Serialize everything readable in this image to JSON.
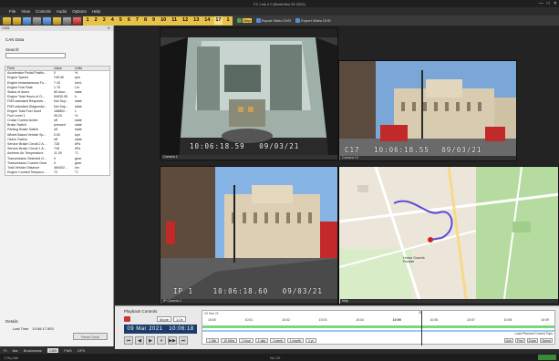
{
  "window": {
    "title": "FC Link 2.0 (Build Mar 25 2022)",
    "controls": [
      "—",
      "□",
      "✕"
    ]
  },
  "menu": [
    "File",
    "View",
    "Controls",
    "Audio",
    "Options",
    "Help"
  ],
  "toolbar": {
    "camera_numbers": [
      "1",
      "2",
      "3",
      "4",
      "5",
      "6",
      "7",
      "8",
      "9",
      "10",
      "11",
      "12",
      "13",
      "14",
      "17",
      "1"
    ],
    "map_label": "Map",
    "export_video_label": "Export Video DVD",
    "export_file_label": "Export Video DVD"
  },
  "left_panel": {
    "header_left": "CAN",
    "header_right": "✕",
    "title": "CAN Data",
    "search_label": "Search:",
    "search_value": "",
    "columns": [
      "Field",
      "Value",
      "Units"
    ],
    "rows": [
      [
        "Accelerator Pedal Positio...",
        "0",
        "%"
      ],
      [
        "Engine Speed",
        "749.50",
        "rpm"
      ],
      [
        "Engine Instantaneous Fu...",
        "7.30",
        "km/L"
      ],
      [
        "Engine Fuel Rate",
        "1.75",
        "L/h"
      ],
      [
        "Status of doors",
        "All door...",
        "state"
      ],
      [
        "Engine Total Hours of O...",
        "54630.95",
        "h"
      ],
      [
        "FMS-standard Requests...",
        "Not Sup...",
        "state"
      ],
      [
        "FMS-standard Diagnostic...",
        "Not Sup...",
        "state"
      ],
      [
        "Engine Total Fuel Used",
        "168802...",
        "L"
      ],
      [
        "Fuel Level 1",
        "95.20",
        "%"
      ],
      [
        "Cruise Control Active",
        "off",
        "state"
      ],
      [
        "Brake Switch",
        "pressed",
        "state"
      ],
      [
        "Parking Brake Switch",
        "off",
        "state"
      ],
      [
        "Wheel-Based Vehicle Sp...",
        "0.00",
        "kph"
      ],
      [
        "Clutch Switch",
        "off",
        "state"
      ],
      [
        "Service Brake Circuit 2 A...",
        "728",
        "kPa"
      ],
      [
        "Service Brake Circuit 1 A...",
        "728",
        "kPa"
      ],
      [
        "Ambient Air Temperature",
        "11.09",
        "°C"
      ],
      [
        "Transmission Selected G...",
        "0",
        "gear"
      ],
      [
        "Transmission Current Gear",
        "0",
        "gear"
      ],
      [
        "Total Vehicle Distance",
        "469402...",
        "km"
      ],
      [
        "Engine Coolant Tempera...",
        "72",
        "°C"
      ]
    ],
    "details_label": "Details",
    "last_time_label": "Last Time",
    "last_time_value": "10:06:17.593",
    "reset_label": "Reset Data",
    "tabs": [
      "FI",
      "Bar",
      "Bookmarks",
      "CAN",
      "FMS",
      "GPS"
    ],
    "active_tab": "CAN"
  },
  "cameras": [
    {
      "label": "Camera 1",
      "osd_id": "",
      "osd_time": "10:06:18.59",
      "osd_date": "09/03/21"
    },
    {
      "label": "Camera 13",
      "osd_id": "C17",
      "osd_time": "10:06:18.55",
      "osd_date": "09/03/21"
    },
    {
      "label": "IP Camera 1",
      "osd_id": "IP 1",
      "osd_time": "10:06:18.60",
      "osd_date": "09/03/21"
    },
    {
      "label": "Map",
      "osd_id": "",
      "osd_time": "",
      "osd_date": ""
    }
  ],
  "map_labels": [
    "Horse Guards Parade"
  ],
  "playback": {
    "title": "Playback Controls",
    "mode": "Mode",
    "rate": "1.0x",
    "date": "09 Mar 2021",
    "time": "10:06:18",
    "transport": [
      "⏮",
      "◀",
      "▶",
      "⏸",
      "▶▶",
      "⏭"
    ],
    "timeline_top": "09 Mar 21",
    "ticks": [
      "10:00",
      "10:01",
      "10:02",
      "10:03",
      "10:04",
      "10:05",
      "10:06",
      "10:07",
      "10:08",
      "10:09"
    ],
    "cursor_label": "25",
    "zoom_buttons": [
      "1 Min",
      "10 Mins",
      "1 hour",
      "1 day",
      "1 week",
      "1 month",
      "1 yr"
    ],
    "legend_text": "Load  Planned  Current  Trips",
    "right_buttons": [
      "Link",
      "Find",
      "Zoom",
      "Speed"
    ]
  },
  "statusbar": {
    "left": "1 Rq  Idle",
    "middle": "No 1D"
  }
}
